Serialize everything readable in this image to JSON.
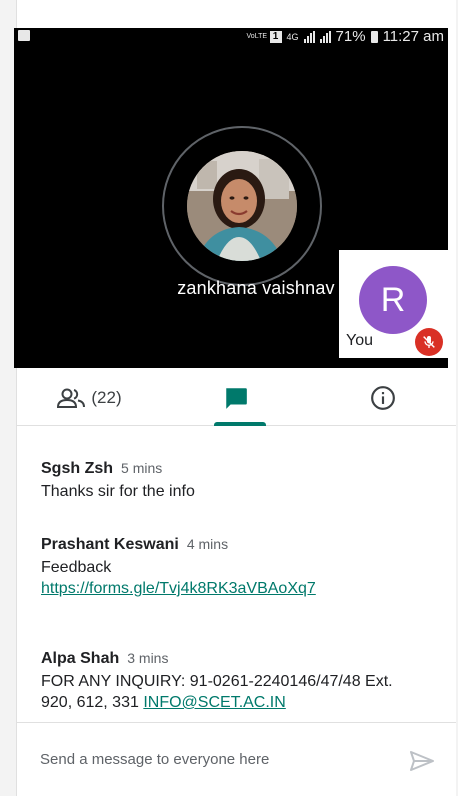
{
  "status_bar": {
    "network_top": "VoLTE",
    "sim_slot": "1",
    "network_type": "4G",
    "battery": "71%",
    "time": "11:27 am"
  },
  "call": {
    "speaker_name": "zankhana vaishnav",
    "self_initial": "R",
    "self_label": "You",
    "self_avatar_color": "#8e57c8",
    "mute_color": "#d93025"
  },
  "tabs": {
    "people_count": "(22)",
    "active": "chat",
    "accent_color": "#00796b",
    "icons": [
      "people-icon",
      "chat-icon",
      "info-icon"
    ]
  },
  "messages": [
    {
      "author": "Sgsh Zsh",
      "time": "5 mins",
      "text": "Thanks sir for the info",
      "link": ""
    },
    {
      "author": "Prashant Keswani",
      "time": "4 mins",
      "text": "Feedback",
      "link": "https://forms.gle/Tvj4k8RK3aVBAoXq7"
    },
    {
      "author": "Alpa Shah",
      "time": "3 mins",
      "text": "FOR ANY INQUIRY: 91-0261-2240146/47/48 Ext. 920, 612, 331",
      "link": "INFO@SCET.AC.IN"
    }
  ],
  "composer": {
    "placeholder": "Send a message to everyone here",
    "value": ""
  }
}
